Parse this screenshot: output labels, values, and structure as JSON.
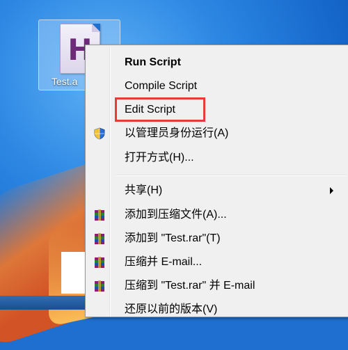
{
  "desktop": {
    "file_label": "Test.a",
    "file_icon_letter": "H"
  },
  "context_menu": {
    "items": [
      {
        "label": "Run Script"
      },
      {
        "label": "Compile Script"
      },
      {
        "label": "Edit Script"
      },
      {
        "label": "以管理员身份运行(A)",
        "icon": "uac-shield-icon"
      },
      {
        "label": "打开方式(H)..."
      },
      {
        "label": "共享(H)"
      },
      {
        "label": "添加到压缩文件(A)...",
        "icon": "winrar-icon"
      },
      {
        "label": "添加到 \"Test.rar\"(T)",
        "icon": "winrar-icon"
      },
      {
        "label": "压缩并 E-mail...",
        "icon": "winrar-icon"
      },
      {
        "label": "压缩到 \"Test.rar\" 并 E-mail",
        "icon": "winrar-icon"
      },
      {
        "label": "还原以前的版本(V)"
      }
    ]
  },
  "colors": {
    "highlight_border": "#e53b3b",
    "menu_background": "#f0f0f0"
  }
}
